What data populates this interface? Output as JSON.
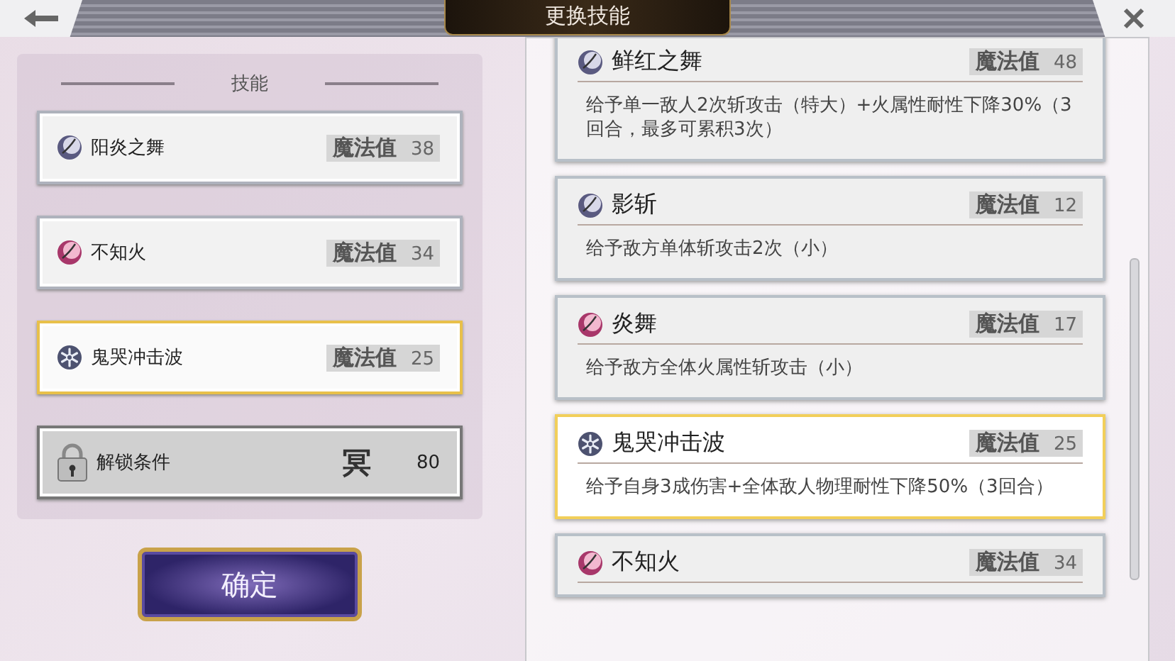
{
  "title": "更换技能",
  "left_panel": {
    "heading": "技能",
    "slots": [
      {
        "kind": "dark",
        "name": "阳炎之舞",
        "mp_label": "魔法值",
        "mp": "38",
        "selected": false
      },
      {
        "kind": "fire",
        "name": "不知火",
        "mp_label": "魔法值",
        "mp": "34",
        "selected": false
      },
      {
        "kind": "ice",
        "name": "鬼哭冲击波",
        "mp_label": "魔法值",
        "mp": "25",
        "selected": true
      },
      {
        "kind": "locked",
        "name": "解锁条件",
        "requirement_glyph": "冥",
        "requirement": "80",
        "selected": false
      }
    ]
  },
  "confirm_button": "确定",
  "skill_list": [
    {
      "kind": "dark",
      "name": "鲜红之舞",
      "mp_label": "魔法值",
      "mp": "48",
      "description": "给予单一敌人2次斩攻击（特大）+火属性耐性下降30%（3回合，最多可累积3次）",
      "selected": false
    },
    {
      "kind": "dark",
      "name": "影斩",
      "mp_label": "魔法值",
      "mp": "12",
      "description": "给予敌方单体斩攻击2次（小）",
      "selected": false
    },
    {
      "kind": "fire",
      "name": "炎舞",
      "mp_label": "魔法值",
      "mp": "17",
      "description": "给予敌方全体火属性斩攻击（小）",
      "selected": false
    },
    {
      "kind": "ice",
      "name": "鬼哭冲击波",
      "mp_label": "魔法值",
      "mp": "25",
      "description": "给予自身3成伤害+全体敌人物理耐性下降50%（3回合）",
      "selected": true
    },
    {
      "kind": "fire",
      "name": "不知火",
      "mp_label": "魔法值",
      "mp": "34",
      "selected": false
    }
  ]
}
